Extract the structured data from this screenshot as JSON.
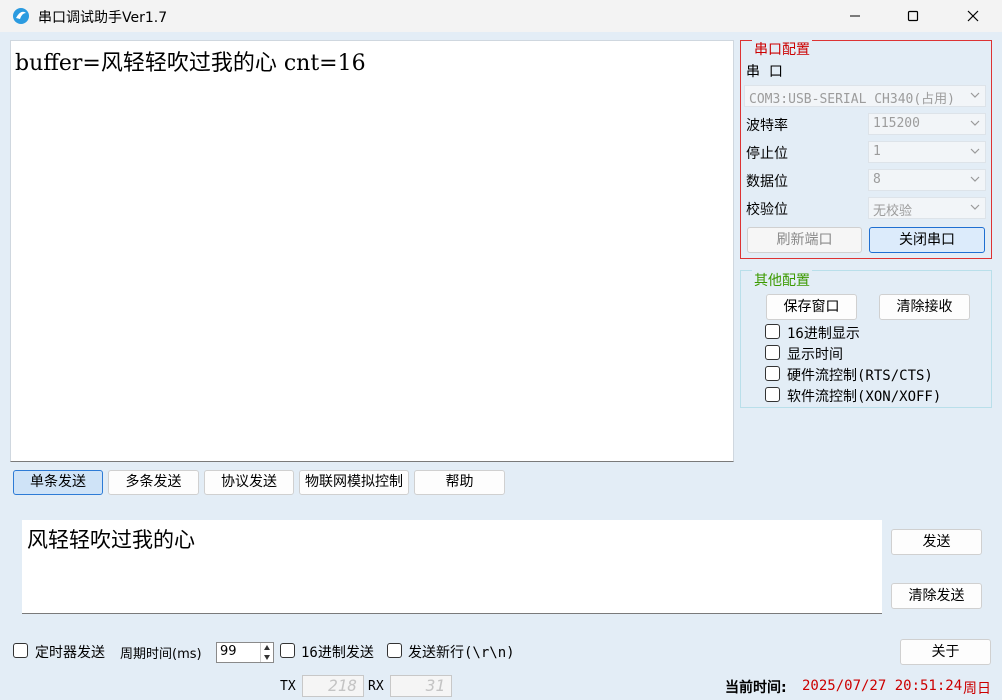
{
  "window": {
    "title": "串口调试助手Ver1.7"
  },
  "receive": {
    "text": "buffer=风轻轻吹过我的心 cnt=16"
  },
  "serial_config": {
    "legend": "串口配置",
    "port_label": "串  口",
    "port_value": "COM3:USB-SERIAL CH340(占用)",
    "baud_label": "波特率",
    "baud_value": "115200",
    "stop_label": "停止位",
    "stop_value": "1",
    "data_label": "数据位",
    "data_value": "8",
    "parity_label": "校验位",
    "parity_value": "无校验",
    "refresh_button": "刷新端口",
    "close_button": "关闭串口"
  },
  "other_config": {
    "legend": "其他配置",
    "save_window_button": "保存窗口",
    "clear_receive_button": "清除接收",
    "hex_display": "16进制显示",
    "show_time": "显示时间",
    "hw_flow": "硬件流控制(RTS/CTS)",
    "sw_flow": "软件流控制(XON/XOFF)"
  },
  "tabs": [
    {
      "label": "单条发送",
      "active": true
    },
    {
      "label": "多条发送",
      "active": false
    },
    {
      "label": "协议发送",
      "active": false
    },
    {
      "label": "物联网模拟控制",
      "active": false
    },
    {
      "label": "帮助",
      "active": false
    }
  ],
  "send": {
    "text": "风轻轻吹过我的心",
    "send_button": "发送",
    "clear_button": "清除发送"
  },
  "bottom": {
    "timer_send": "定时器发送",
    "period_label": "周期时间(ms)",
    "period_value": "99",
    "hex_send": "16进制发送",
    "send_newline": "发送新行(\\r\\n)",
    "about_button": "关于",
    "tx_label": "TX",
    "tx_value": "218",
    "rx_label": "RX",
    "rx_value": "31",
    "time_label": "当前时间:",
    "time_value": "2025/07/27 20:51:24",
    "weekday": "周日"
  },
  "colors": {
    "accent": "#1f6fd1",
    "serial_border": "#cc0000",
    "other_legend": "#3c9a00",
    "panel_bg": "#e3edf6"
  }
}
